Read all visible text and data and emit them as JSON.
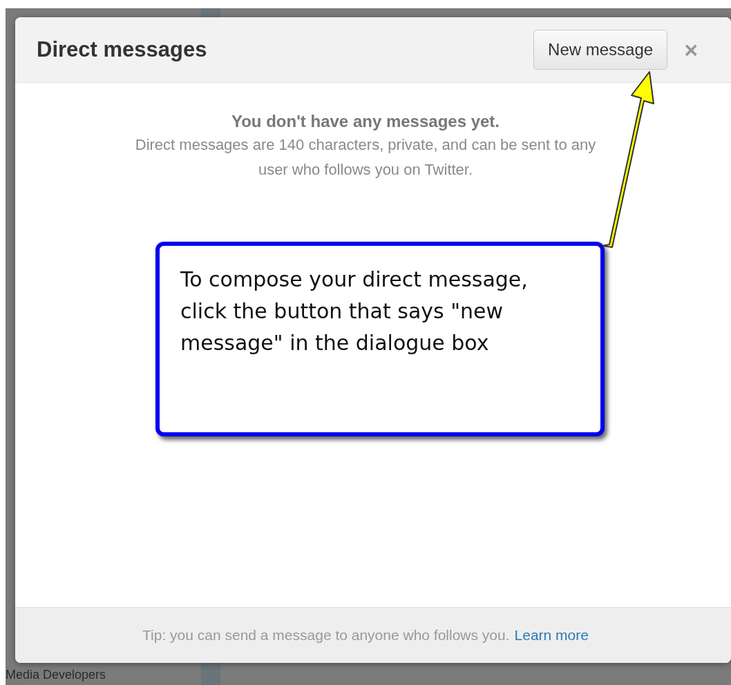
{
  "background": {
    "text": "Media Developers"
  },
  "dialog": {
    "title": "Direct messages",
    "new_button": "New message",
    "close": "×",
    "empty_heading": "You don't have any messages yet.",
    "empty_text": "Direct messages are 140 characters, private, and can be sent to any user who follows you on Twitter.",
    "footer_tip": "Tip: you can send a message to anyone who follows you.",
    "footer_link": "Learn more"
  },
  "callout": {
    "text": "To compose your direct message, click the button that says \"new message\" in the dialogue box"
  }
}
